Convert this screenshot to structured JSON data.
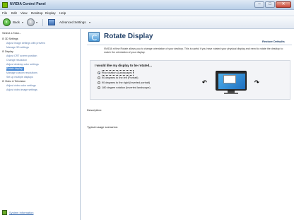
{
  "window": {
    "title": "NVIDIA Control Panel",
    "minimize": "–",
    "maximize": "□",
    "close": "✕"
  },
  "menu": [
    "File",
    "Edit",
    "View",
    "Desktop",
    "Display",
    "Help"
  ],
  "toolbar": {
    "back_label": "Back",
    "forward_glyph": "›",
    "back_glyph": "‹",
    "dropdown_glyph": "▾",
    "advanced_settings_label": "Advanced Settings",
    "icons": [
      "back-icon",
      "forward-icon",
      "home-icon"
    ]
  },
  "sidebar": {
    "header": "Select a Task...",
    "tree": [
      {
        "label": "⊟ 3D Settings",
        "kind": "category",
        "selected": false
      },
      {
        "label": "Adjust image settings with preview",
        "kind": "item",
        "selected": false
      },
      {
        "label": "Manage 3D settings",
        "kind": "item",
        "selected": false
      },
      {
        "label": "⊟ Display",
        "kind": "category",
        "selected": false
      },
      {
        "label": "Adjust CRT screen position",
        "kind": "item",
        "selected": false
      },
      {
        "label": "Change resolution",
        "kind": "item",
        "selected": false
      },
      {
        "label": "Adjust desktop color settings",
        "kind": "item",
        "selected": false
      },
      {
        "label": "Rotate display",
        "kind": "item",
        "selected": true
      },
      {
        "label": "Manage custom resolutions",
        "kind": "item",
        "selected": false
      },
      {
        "label": "Set up multiple displays",
        "kind": "item",
        "selected": false
      },
      {
        "label": "⊟ Video & Television",
        "kind": "category",
        "selected": false
      },
      {
        "label": "Adjust video color settings",
        "kind": "item",
        "selected": false
      },
      {
        "label": "Adjust video image settings",
        "kind": "item",
        "selected": false
      }
    ],
    "system_info_label": "System Information"
  },
  "main": {
    "title": "Rotate Display",
    "restore_defaults": "Restore Defaults",
    "description": "NVIDIA nView Rotate allows you to change orientation of your desktop. This is useful if you have rotated your physical display and need to rotate the desktop to match the orientation of your display.",
    "panel": {
      "question": "I would like my display to be rotated...",
      "options": [
        {
          "label": "No rotation (Landscape)",
          "selected": true
        },
        {
          "label": "90 degrees to the left (Portrait)",
          "selected": false
        },
        {
          "label": "90 degrees to the right (Inverted portrait)",
          "selected": false
        },
        {
          "label": "180 degree rotation (Inverted landscape)",
          "selected": false
        }
      ],
      "rotate_ccw_glyph": "↶",
      "rotate_cw_glyph": "↷"
    },
    "description_label": "Description:",
    "typical_usage_label": "Typical usage scenarios:"
  },
  "colors": {
    "accent": "#76b900",
    "selection": "#4a8bd6",
    "title": "#1f3e66"
  }
}
